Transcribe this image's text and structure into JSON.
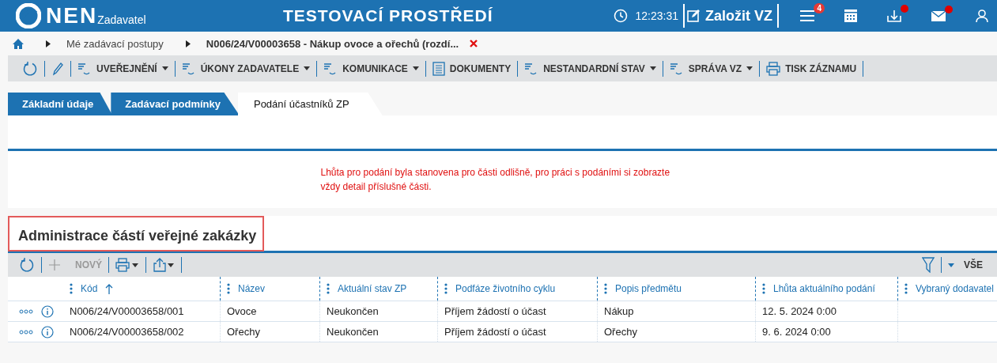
{
  "header": {
    "logo": "NEN",
    "subtitle": "Zadavatel",
    "title": "TESTOVACÍ PROSTŘEDÍ",
    "time": "12:23:31",
    "create_button": "Založit VZ",
    "menu_badge": "4",
    "inbox_alert": true,
    "mail_alert": true
  },
  "breadcrumb": {
    "items": [
      "Mé zadávací postupy",
      "N006/24/V00003658 - Nákup ovoce a ořechů (rozdí..."
    ]
  },
  "toolbar": [
    {
      "kind": "refresh"
    },
    {
      "kind": "edit"
    },
    {
      "kind": "menu",
      "label": "UVEŘEJNĚNÍ"
    },
    {
      "kind": "menu",
      "label": "ÚKONY ZADAVATELE"
    },
    {
      "kind": "menu",
      "label": "KOMUNIKACE"
    },
    {
      "kind": "doc",
      "label": "DOKUMENTY"
    },
    {
      "kind": "menu",
      "label": "NESTANDARDNÍ STAV"
    },
    {
      "kind": "menu",
      "label": "SPRÁVA VZ"
    },
    {
      "kind": "print",
      "label": "TISK ZÁZNAMU"
    }
  ],
  "tabs": [
    {
      "label": "Základní údaje",
      "selected": false
    },
    {
      "label": "Zadávací podmínky",
      "selected": false
    },
    {
      "label": "Podání účastníků ZP",
      "selected": true
    }
  ],
  "message": "Lhůta pro podání byla stanovena pro části odlišně, pro práci s podáními si zobrazte vždy detail příslušné části.",
  "section": {
    "title": "Administrace částí veřejné zakázky",
    "highlighted": true,
    "toolbar": {
      "new_label": "NOVÝ",
      "new_disabled": true,
      "filter_label": "VŠE"
    },
    "table": {
      "columns": [
        {
          "label": "Kód",
          "sorted": true
        },
        {
          "label": "Název",
          "sorted": false
        },
        {
          "label": "Aktuální stav ZP",
          "sorted": false
        },
        {
          "label": "Podfáze životního cyklu",
          "sorted": false
        },
        {
          "label": "Popis předmětu",
          "sorted": false
        },
        {
          "label": "Lhůta aktuálního podání",
          "sorted": false
        },
        {
          "label": "Vybraný dodavatel",
          "sorted": false
        }
      ],
      "rows": [
        [
          "N006/24/V00003658/001",
          "Ovoce",
          "Neukončen",
          "Příjem žádostí o účast",
          "Nákup",
          "12. 5. 2024 0:00"
        ],
        [
          "N006/24/V00003658/002",
          "Ořechy",
          "Neukončen",
          "Příjem žádostí o účast",
          "Ořechy",
          "9. 6. 2024 0:00"
        ]
      ]
    }
  }
}
